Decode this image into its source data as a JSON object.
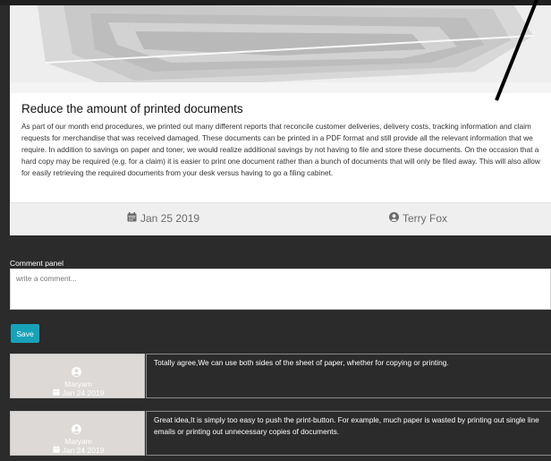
{
  "article": {
    "title": "Reduce the amount of printed documents",
    "body": "As part of our month end procedures, we printed out many different reports that reconcile customer deliveries, delivery costs, tracking information and claim requests for merchandise that was received damaged. These documents can be printed in a PDF format and still provide all the relevant information that we require. In addition to savings on paper and toner, we would realize additional savings by not having to file and store these documents. On the occasion that a hard copy may be required (e.g. for a claim) it is easier to print one document rather than a bunch of documents that will only be filed away. This will also allow for easily retrieving the required documents from your desk versus having to go a filing cabinet.",
    "date": "Jan 25 2019",
    "author": "Terry Fox",
    "date_icon": "calendar-icon",
    "author_icon": "user-circle-icon"
  },
  "comment_panel": {
    "label": "Comment panel",
    "placeholder": "write a comment...",
    "save_label": "Save"
  },
  "comments": [
    {
      "user": "Maryam",
      "date": "Jan 24 2019",
      "text": "Totally agree,We can use both sides of the sheet of paper, whether for copying or printing."
    },
    {
      "user": "Maryam",
      "date": "Jan 24 2019",
      "text": "Great idea,It is simply too easy to push the print-button. For example, much paper is wasted by printing out single line emails or printing out unnecessary copies of documents."
    }
  ],
  "colors": {
    "background": "#2b2b2b",
    "accent": "#17a2b8",
    "comment_user_bg": "#dcd9d6"
  }
}
